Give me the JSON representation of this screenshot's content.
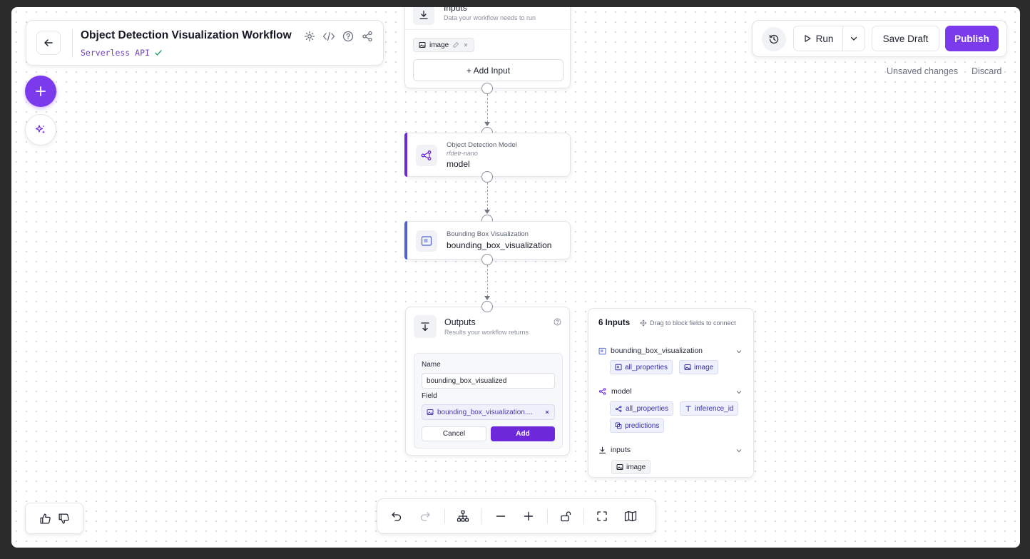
{
  "header": {
    "title": "Object Detection Visualization Workflow",
    "subtitle": "Serverless API"
  },
  "toolbar": {
    "run_label": "Run",
    "save_draft_label": "Save Draft",
    "publish_label": "Publish",
    "unsaved_label": "Unsaved changes",
    "discard_label": "Discard"
  },
  "inputs_node": {
    "title": "Inputs",
    "description": "Data your workflow needs to run",
    "chip_label": "image",
    "add_input_label": "+ Add Input"
  },
  "model_node": {
    "type": "Object Detection Model",
    "model_id": "rfdetr-nano",
    "name": "model",
    "accent": "#6d28d9"
  },
  "viz_node": {
    "type": "Bounding Box Visualization",
    "name": "bounding_box_visualization",
    "accent": "#4f5fd6"
  },
  "outputs_node": {
    "title": "Outputs",
    "description": "Results your workflow returns",
    "name_label": "Name",
    "name_value": "bounding_box_visualized",
    "field_label": "Field",
    "field_value": "bounding_box_visualization....",
    "cancel_label": "Cancel",
    "add_label": "Add"
  },
  "inputs_panel": {
    "title": "6 Inputs",
    "hint": "Drag to block fields to connect",
    "groups": [
      {
        "name": "bounding_box_visualization",
        "chips": [
          "all_properties",
          "image"
        ]
      },
      {
        "name": "model",
        "chips": [
          "all_properties",
          "inference_id",
          "predictions"
        ]
      },
      {
        "name": "inputs",
        "chips": [
          "image"
        ]
      }
    ]
  },
  "colors": {
    "brand": "#7c3aed",
    "accent_model": "#6d28d9",
    "accent_viz": "#4f5fd6"
  }
}
